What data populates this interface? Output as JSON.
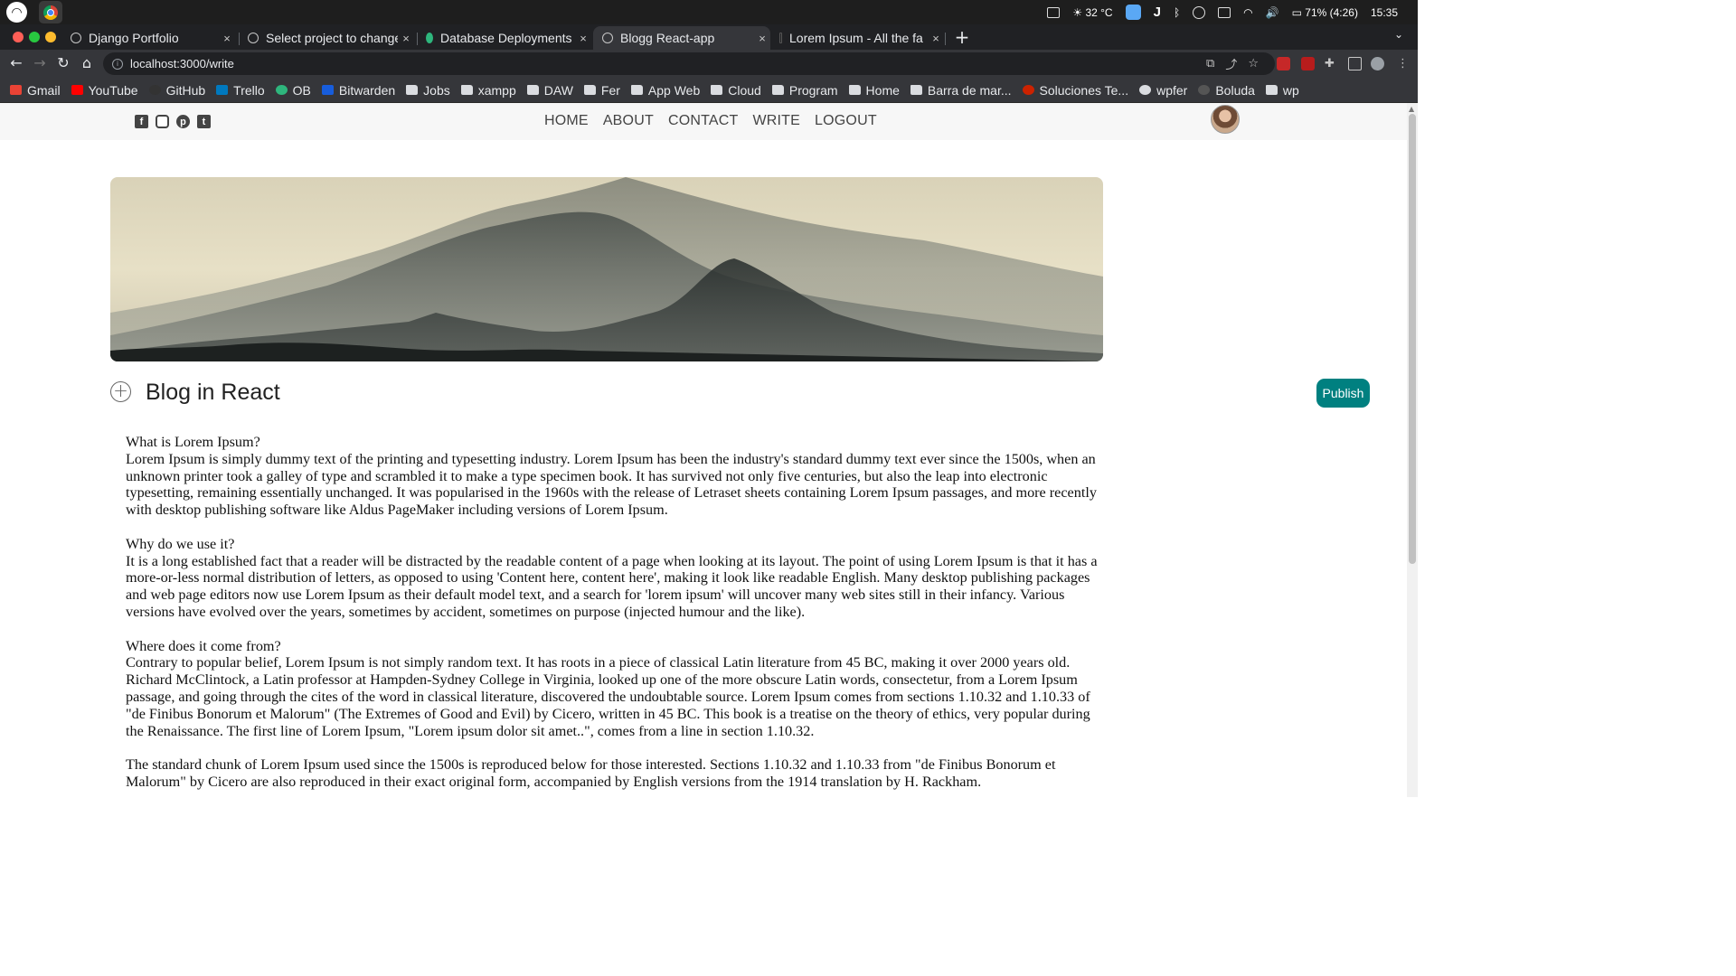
{
  "os": {
    "tray": {
      "temperature": "32 °C",
      "battery": "71% (4:26)",
      "clock": "15:35"
    }
  },
  "browser": {
    "tabs": [
      {
        "label": "Django Portfolio",
        "close": "×"
      },
      {
        "label": "Select project to change",
        "close": "×"
      },
      {
        "label": "Database Deployments |",
        "close": "×"
      },
      {
        "label": "Blogg React-app",
        "close": "×"
      },
      {
        "label": "Lorem Ipsum - All the fa",
        "close": "×"
      }
    ],
    "new_tab": "+",
    "url": "localhost:3000/write",
    "bookmarks": [
      {
        "label": "Gmail",
        "icon": "gmail-icon",
        "color": "#ea4335"
      },
      {
        "label": "YouTube",
        "icon": "youtube-icon",
        "color": "#ff0000"
      },
      {
        "label": "GitHub",
        "icon": "github-icon",
        "color": "#333333"
      },
      {
        "label": "Trello",
        "icon": "trello-icon",
        "color": "#0079bf"
      },
      {
        "label": "OB",
        "icon": "ob-icon",
        "color": "#2eb67d"
      },
      {
        "label": "Bitwarden",
        "icon": "bitwarden-icon",
        "color": "#175ddc"
      },
      {
        "label": "Jobs",
        "icon": "folder-icon"
      },
      {
        "label": "xampp",
        "icon": "folder-icon"
      },
      {
        "label": "DAW",
        "icon": "folder-icon"
      },
      {
        "label": "Fer",
        "icon": "folder-icon"
      },
      {
        "label": "App Web",
        "icon": "folder-icon"
      },
      {
        "label": "Cloud",
        "icon": "folder-icon"
      },
      {
        "label": "Program",
        "icon": "folder-icon"
      },
      {
        "label": "Home",
        "icon": "folder-icon"
      },
      {
        "label": "Barra de mar...",
        "icon": "folder-icon"
      },
      {
        "label": "Soluciones Te...",
        "icon": "solutions-icon",
        "color": "#cc2200"
      },
      {
        "label": "wpfer",
        "icon": "globe-icon",
        "color": "#dadce0"
      },
      {
        "label": "Boluda",
        "icon": "globe-icon",
        "color": "#555555"
      },
      {
        "label": "wp",
        "icon": "folder-icon"
      }
    ]
  },
  "site": {
    "nav": [
      "HOME",
      "ABOUT",
      "CONTACT",
      "WRITE",
      "LOGOUT"
    ],
    "social": [
      "facebook-icon",
      "instagram-icon",
      "pinterest-icon",
      "twitter-icon"
    ],
    "accent": "#008080"
  },
  "write": {
    "add_symbol": "+",
    "title": "Blog in React",
    "publish_label": "Publish",
    "paragraphs": [
      "What is Lorem Ipsum?\nLorem Ipsum is simply dummy text of the printing and typesetting industry. Lorem Ipsum has been the industry's standard dummy text ever since the 1500s, when an unknown printer took a galley of type and scrambled it to make a type specimen book. It has survived not only five centuries, but also the leap into electronic typesetting, remaining essentially unchanged. It was popularised in the 1960s with the release of Letraset sheets containing Lorem Ipsum passages, and more recently with desktop publishing software like Aldus PageMaker including versions of Lorem Ipsum.",
      "Why do we use it?\nIt is a long established fact that a reader will be distracted by the readable content of a page when looking at its layout. The point of using Lorem Ipsum is that it has a more-or-less normal distribution of letters, as opposed to using 'Content here, content here', making it look like readable English. Many desktop publishing packages and web page editors now use Lorem Ipsum as their default model text, and a search for 'lorem ipsum' will uncover many web sites still in their infancy. Various versions have evolved over the years, sometimes by accident, sometimes on purpose (injected humour and the like).",
      "Where does it come from?\nContrary to popular belief, Lorem Ipsum is not simply random text. It has roots in a piece of classical Latin literature from 45 BC, making it over 2000 years old. Richard McClintock, a Latin professor at Hampden-Sydney College in Virginia, looked up one of the more obscure Latin words, consectetur, from a Lorem Ipsum passage, and going through the cites of the word in classical literature, discovered the undoubtable source. Lorem Ipsum comes from sections 1.10.32 and 1.10.33 of \"de Finibus Bonorum et Malorum\" (The Extremes of Good and Evil) by Cicero, written in 45 BC. This book is a treatise on the theory of ethics, very popular during the Renaissance. The first line of Lorem Ipsum, \"Lorem ipsum dolor sit amet..\", comes from a line in section 1.10.32.",
      "The standard chunk of Lorem Ipsum used since the 1500s is reproduced below for those interested. Sections 1.10.32 and 1.10.33 from \"de Finibus Bonorum et Malorum\" by Cicero are also reproduced in their exact original form, accompanied by English versions from the 1914 translation by H. Rackham."
    ]
  }
}
